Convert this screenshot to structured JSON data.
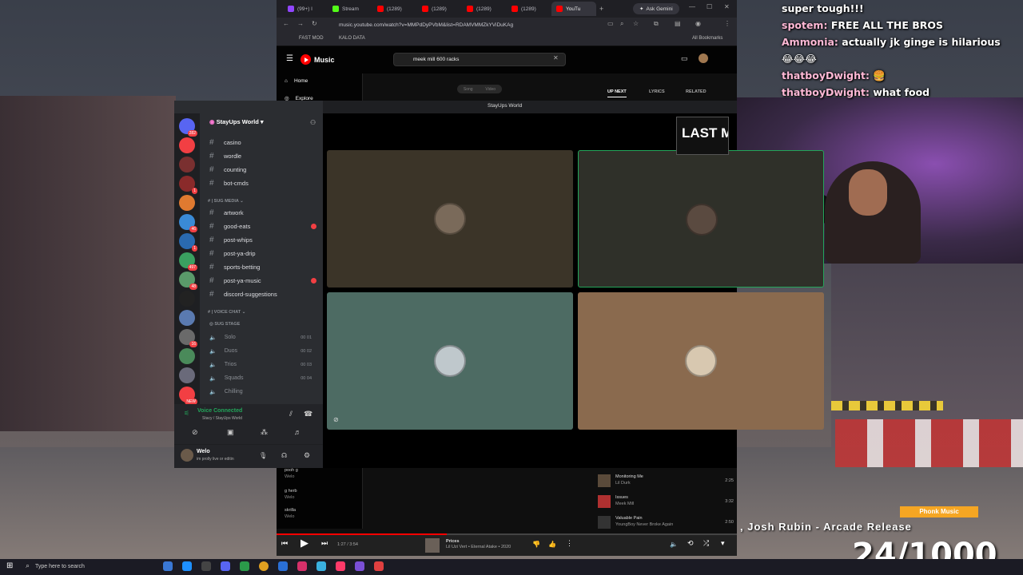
{
  "chat": [
    {
      "name": "",
      "text": "super tough!!!"
    },
    {
      "name": "spotem:",
      "text": "FREE ALL THE BROS"
    },
    {
      "name": "Ammonia:",
      "text": "actually jk ginge is hilarious"
    },
    {
      "name": "",
      "text": "😂😂😂"
    },
    {
      "name": "thatboyDwight:",
      "text": "🍔"
    },
    {
      "name": "thatboyDwight:",
      "text": "what food"
    }
  ],
  "browser": {
    "tabs": [
      "(99+) I",
      "Stream",
      "(1289)",
      "(1289)",
      "(1289)",
      "(1289)",
      "YouTu"
    ],
    "gemini": "Ask Gemini",
    "url": "music.youtube.com/watch?v=MMPdDyPVbM&list=RDAMVMMZkYViDuKAg",
    "bookmarks": [
      "FAST MOD",
      "KALO DATA"
    ],
    "all_bookmarks": "All Bookmarks"
  },
  "ytm": {
    "logo": "Music",
    "search_value": "meek mill 600 racks",
    "nav": [
      "Home",
      "Explore"
    ],
    "toggle": [
      "Song",
      "Video"
    ],
    "right_tabs": [
      "UP NEXT",
      "LYRICS",
      "RELATED"
    ],
    "queue": [
      {
        "title": "Monitoring Me",
        "artist": "Lil Durk",
        "duration": "2:25"
      },
      {
        "title": "Issues",
        "artist": "Meek Mill",
        "duration": "3:32"
      },
      {
        "title": "Valuable Pain",
        "artist": "YoungBoy Never Broke Again",
        "duration": "2:50"
      }
    ],
    "library": [
      {
        "title": "pooh g",
        "sub": "Welo"
      },
      {
        "title": "g herb",
        "sub": "Welo"
      },
      {
        "title": "skrilla",
        "sub": "Welo"
      }
    ],
    "player": {
      "time": "1:27 / 3:54",
      "progress": 0.37,
      "track": "Prices",
      "sub": "Lil Uzi Vert • Eternal Atake • 2020"
    }
  },
  "discord": {
    "server": "StayUps World",
    "stage_title": "StayUps World",
    "guild_badges": [
      "282",
      "",
      "",
      "1",
      "",
      "46",
      "1",
      "497",
      "48",
      "",
      "",
      "16",
      "",
      "",
      "NEW"
    ],
    "channels_top": [
      {
        "name": "casino",
        "unread": false
      },
      {
        "name": "wordle",
        "unread": false
      },
      {
        "name": "counting",
        "unread": false
      },
      {
        "name": "bot-cmds",
        "unread": false
      }
    ],
    "category_media": "SUG MEDIA",
    "channels_media": [
      {
        "name": "artwork",
        "unread": false
      },
      {
        "name": "good-eats",
        "unread": true
      },
      {
        "name": "post-whips",
        "unread": false
      },
      {
        "name": "post-ya-drip",
        "unread": false
      },
      {
        "name": "sports-betting",
        "unread": false
      },
      {
        "name": "post-ya-music",
        "unread": true
      },
      {
        "name": "discord-suggestions",
        "unread": false
      }
    ],
    "category_voice": "VOICE CHAT",
    "stage": "SUG STAGE",
    "voice": [
      {
        "name": "Solo",
        "count": "00 01"
      },
      {
        "name": "Duos",
        "count": "00 02"
      },
      {
        "name": "Trios",
        "count": "00 03"
      },
      {
        "name": "Squads",
        "count": "00 04"
      },
      {
        "name": "Chilling",
        "count": ""
      }
    ],
    "voice_connected": "Voice Connected",
    "voice_sub": "Stacy / StayUps World",
    "user": "Welo",
    "user_status": "im prolly live or editin",
    "tile_colors": [
      "#3b3428",
      "#2f3029",
      "#4d6b63",
      "#8a6a4e"
    ]
  },
  "stream": {
    "overlay_text": "LAST M",
    "genre": "Phonk Music",
    "now_playing": ", Josh Rubin - Arcade Release",
    "goal": "24/1000"
  },
  "taskbar": {
    "search_placeholder": "Type here to search"
  }
}
